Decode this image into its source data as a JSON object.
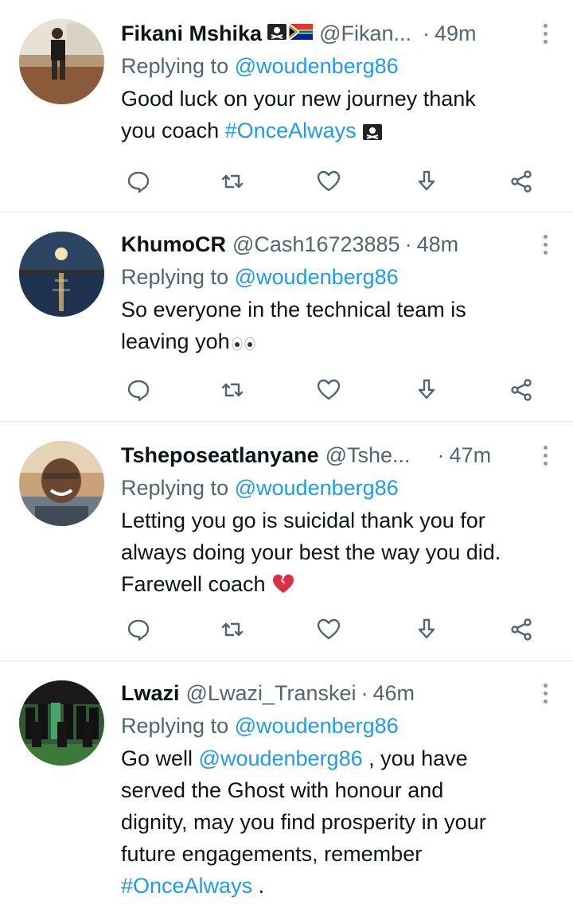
{
  "tweets": [
    {
      "name": "Fikani Mshika",
      "handle": "@Fikan...",
      "time": "49m",
      "replying_prefix": "Replying to",
      "replying_to": "@woudenberg86",
      "body_line1": "Good luck on your new journey thank",
      "body_line2_text": "you coach ",
      "body_line2_hashtag": "#OnceAlways",
      "name_emojis": [
        "pirate-flag-icon",
        "south-africa-flag-icon"
      ],
      "body_emoji": "pirate-flag-icon"
    },
    {
      "name": "KhumoCR",
      "handle": "@Cash16723885",
      "time": "48m",
      "replying_prefix": "Replying to",
      "replying_to": "@woudenberg86",
      "body_line1": "So everyone in the technical team is",
      "body_line2_text": "leaving yoh",
      "body_emoji": "eyes-icon"
    },
    {
      "name": "Tsheposeatlanyane",
      "handle": "@Tshe...",
      "time": "47m",
      "replying_prefix": "Replying to",
      "replying_to": "@woudenberg86",
      "body_line1": "Letting you go is suicidal thank you for",
      "body_line2_text": "always doing your best the way you did.",
      "body_line3_text": "Farewell coach ",
      "body_emoji": "broken-heart-icon"
    },
    {
      "name": "Lwazi",
      "handle": "@Lwazi_Transkei",
      "time": "46m",
      "replying_prefix": "Replying to",
      "replying_to": "@woudenberg86",
      "body_line1_prefix": "Go well ",
      "body_line1_mention": "@woudenberg86",
      "body_line1_suffix": " , you have",
      "body_line2_text": "served the Ghost with honour and",
      "body_line3_text": "dignity, may you find prosperity in your",
      "body_line4_text": "future engagements, remember",
      "body_line5_hashtag": "#OnceAlways",
      "body_line5_suffix": " ."
    }
  ],
  "separator": "·",
  "actions": [
    "reply-icon",
    "retweet-icon",
    "like-icon",
    "download-icon",
    "share-icon"
  ],
  "colors": {
    "link": "#1d9bf0",
    "secondary_text": "#536471",
    "primary_text": "#0f1419",
    "divider": "#e6ecf0"
  }
}
